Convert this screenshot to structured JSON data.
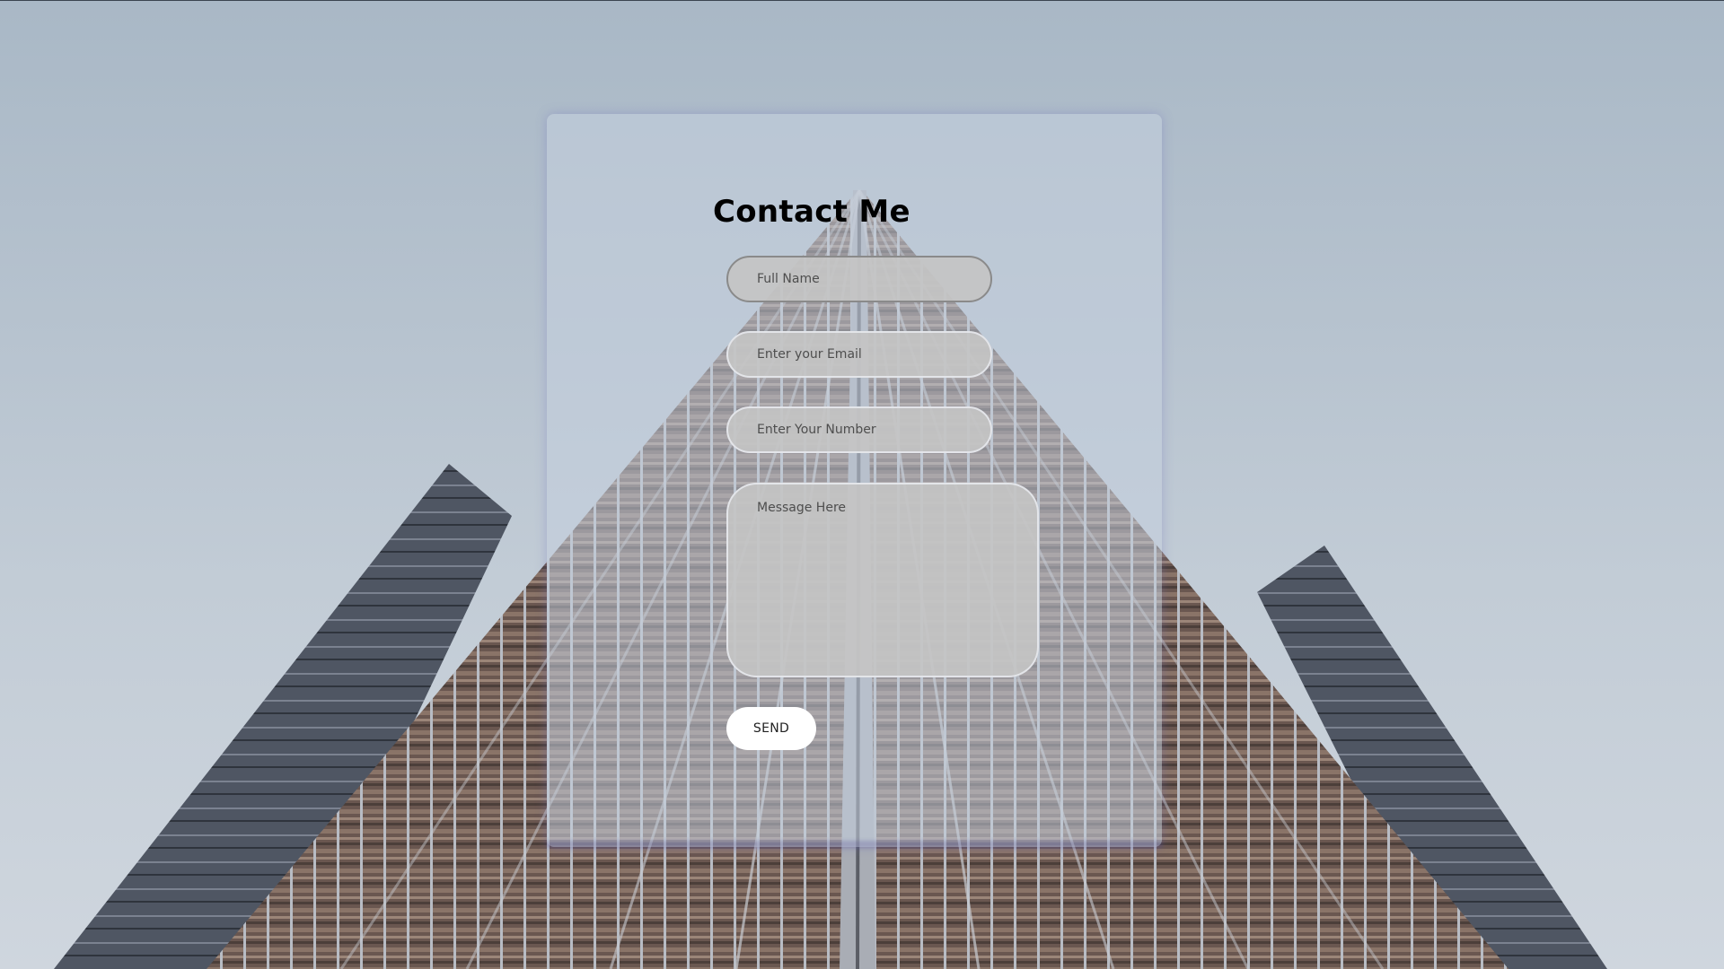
{
  "form": {
    "title": "Contact Me",
    "fields": {
      "full_name": {
        "value": "",
        "placeholder": "Full Name"
      },
      "email": {
        "value": "",
        "placeholder": "Enter your Email"
      },
      "number": {
        "value": "",
        "placeholder": "Enter Your Number"
      },
      "message": {
        "value": "",
        "placeholder": "Message Here"
      }
    },
    "send_label": "SEND"
  },
  "background": {
    "icon": "building-photo",
    "sky_color": "#b7c3cf",
    "facade_color": "#6e5a52"
  },
  "colors": {
    "card": "#c4d0de",
    "field": "#c4c4c4",
    "button": "#ffffff",
    "title": "#000000"
  }
}
